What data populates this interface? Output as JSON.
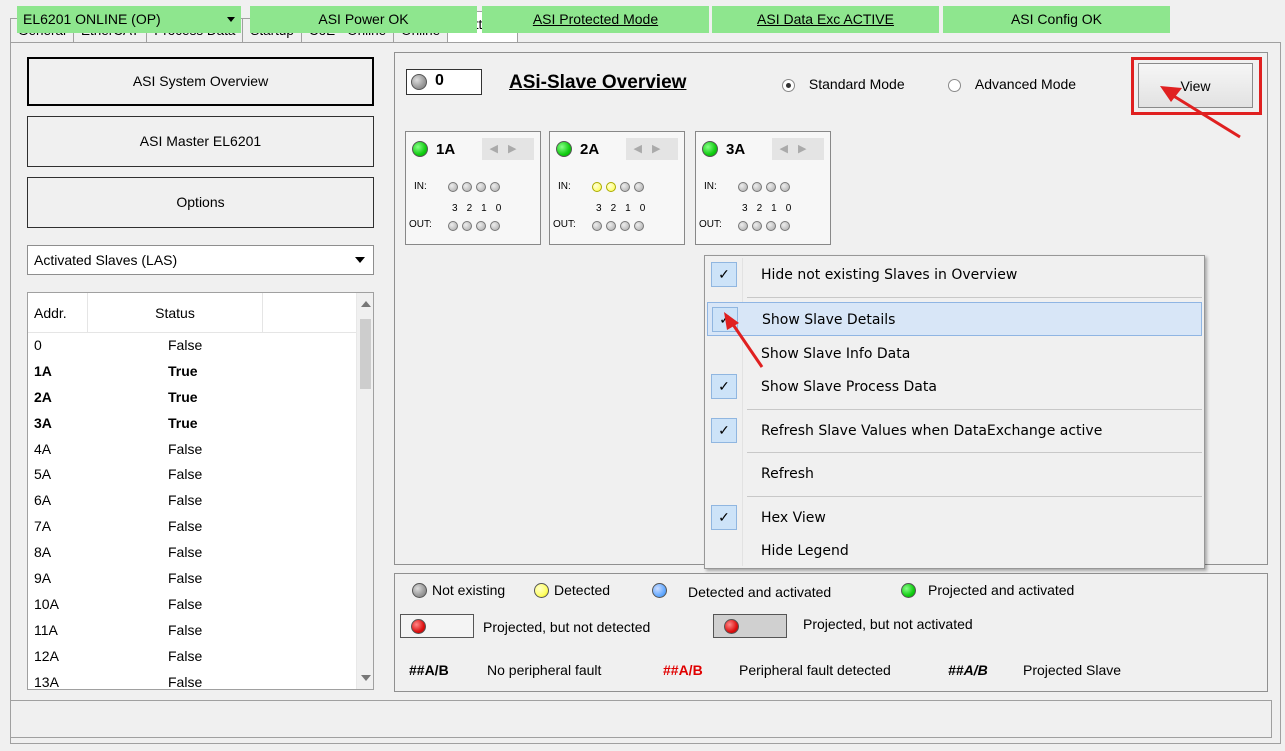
{
  "tabs": [
    "General",
    "EtherCAT",
    "Process Data",
    "Startup",
    "CoE - Online",
    "Online",
    "Settings"
  ],
  "active_tab": "Settings",
  "nav": {
    "system_overview": "ASI System Overview",
    "master": "ASI Master EL6201",
    "options": "Options"
  },
  "slave_filter": {
    "selected": "Activated Slaves (LAS)"
  },
  "slave_table": {
    "headers": [
      "Addr.",
      "Status"
    ],
    "rows": [
      {
        "addr": "0",
        "status": "False",
        "bold": false
      },
      {
        "addr": "1A",
        "status": "True",
        "bold": true
      },
      {
        "addr": "2A",
        "status": "True",
        "bold": true
      },
      {
        "addr": "3A",
        "status": "True",
        "bold": true
      },
      {
        "addr": "4A",
        "status": "False",
        "bold": false
      },
      {
        "addr": "5A",
        "status": "False",
        "bold": false
      },
      {
        "addr": "6A",
        "status": "False",
        "bold": false
      },
      {
        "addr": "7A",
        "status": "False",
        "bold": false
      },
      {
        "addr": "8A",
        "status": "False",
        "bold": false
      },
      {
        "addr": "9A",
        "status": "False",
        "bold": false
      },
      {
        "addr": "10A",
        "status": "False",
        "bold": false
      },
      {
        "addr": "11A",
        "status": "False",
        "bold": false
      },
      {
        "addr": "12A",
        "status": "False",
        "bold": false
      },
      {
        "addr": "13A",
        "status": "False",
        "bold": false
      }
    ]
  },
  "overview": {
    "counter": "0",
    "title": "ASi-Slave Overview",
    "mode_standard": "Standard Mode",
    "mode_advanced": "Advanced Mode",
    "selected_mode": "Standard Mode",
    "view_button": "View",
    "in_label": "IN:",
    "out_label": "OUT:",
    "bit_numbers": [
      "3",
      "2",
      "1",
      "0"
    ],
    "slaves": [
      {
        "name": "1A",
        "status_color": "green",
        "in_bits": [
          "off",
          "off",
          "off",
          "off"
        ]
      },
      {
        "name": "2A",
        "status_color": "green",
        "in_bits": [
          "yellow",
          "yellow",
          "off",
          "off"
        ]
      },
      {
        "name": "3A",
        "status_color": "green",
        "in_bits": [
          "off",
          "off",
          "off",
          "off"
        ]
      }
    ]
  },
  "view_menu": {
    "items": [
      {
        "label": "Hide not existing Slaves in Overview",
        "checked": true
      },
      {
        "label": "Show Slave Details",
        "checked": true,
        "highlighted": true
      },
      {
        "label": "Show Slave Info Data",
        "checked": false
      },
      {
        "label": "Show Slave Process Data",
        "checked": true
      },
      {
        "label": "Refresh Slave Values when DataExchange active",
        "checked": true
      },
      {
        "label": "Refresh",
        "checked": false
      },
      {
        "label": "Hex View",
        "checked": true
      },
      {
        "label": "Hide Legend",
        "checked": false
      }
    ]
  },
  "legend": {
    "not_existing": "Not existing",
    "detected": "Detected",
    "detected_activated": "Detected and activated",
    "projected_activated": "Projected and activated",
    "projected_not_detected": "Projected, but not detected",
    "projected_not_activated": "Projected, but not activated",
    "tag": "##A/B",
    "no_fault": "No peripheral fault",
    "fault": "Peripheral fault detected",
    "projected_slave": "Projected Slave",
    "colors": {
      "fault_tag": "#e00000"
    }
  },
  "status_bar": {
    "state": "EL6201 ONLINE (OP)",
    "power": "ASI Power OK",
    "protected": "ASI Protected Mode",
    "data_exchange": "ASI Data Exc ACTIVE",
    "config": "ASI Config OK",
    "colors": {
      "ok": "#8ee68e"
    }
  },
  "annotation_colors": {
    "highlight": "#e02020"
  }
}
